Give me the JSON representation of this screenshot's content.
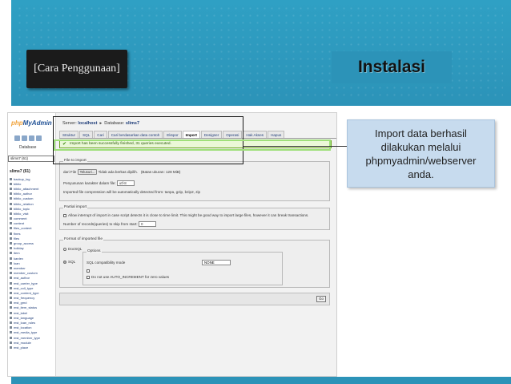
{
  "slide": {
    "section_label": "[Cara Penggunaan]",
    "title": "Instalasi",
    "note_lines": [
      "Import data berhasil",
      "dilakukan melalui",
      "phpmyadmin/webserver",
      "anda."
    ],
    "colors": {
      "header_blue": "#2c93b8",
      "note_bg": "#c7dbee",
      "label_bg": "#1b1b1b",
      "success_border": "#9fe07a"
    }
  },
  "pma": {
    "logo_a": "php",
    "logo_b": "MyAdmin",
    "db_header": "Database",
    "db_select": "slims7 (61)",
    "db_name": "slims7 (61)",
    "tables": [
      "backup_log",
      "biblio",
      "biblio_attachment",
      "biblio_author",
      "biblio_custom",
      "biblio_relation",
      "biblio_topic",
      "biblio_visit",
      "comment",
      "content",
      "files_content",
      "fines",
      "files",
      "group_access",
      "holiday",
      "item",
      "kardex",
      "loan",
      "member",
      "member_custom",
      "mst_author",
      "mst_carrier_type",
      "mst_coll_type",
      "mst_content_type",
      "mst_frequency",
      "mst_gmd",
      "mst_item_status",
      "mst_label",
      "mst_language",
      "mst_loan_rules",
      "mst_location",
      "mst_media_type",
      "mst_member_type",
      "mst_module",
      "mst_place"
    ],
    "breadcrumb_server_label": "Server:",
    "breadcrumb_server": "localhost",
    "breadcrumb_db_label": "Database:",
    "breadcrumb_db": "slims7",
    "tabs": [
      "Struktur",
      "SQL",
      "Cari",
      "Cari berdasarkan data contoh",
      "Ekspor",
      "Import",
      "Designer",
      "Operasi",
      "Hak Akses",
      "Hapus"
    ],
    "success_message": "Import has been successfully finished, 31 queries executed.",
    "file_legend": "File to import",
    "file_label": "dari File",
    "file_button": "Telusuri...",
    "file_status": "Tidak ada berkas dipilih.",
    "file_max": "(Batas ukuran: 128 MiB)",
    "charset_label": "Penyusunan karakter dalam file:",
    "charset_value": "utf-8",
    "compression_note": "Imported file compression will be automatically detected from: tanpa, gzip, bzip2, zip",
    "partial_legend": "Partial import",
    "partial_allow": "Allow interrupt of import in case script detects it is close to time limit. This might be good way to import large files, however it can break transactions.",
    "partial_skip": "Number of records(queries) to skip from start:",
    "partial_skip_value": "0",
    "format_legend": "Format of imported file",
    "format_docsql": "DocSQL",
    "format_sql": "SQL",
    "options_legend": "Options",
    "sql_compat_label": "SQL compatibility mode",
    "sql_compat_value": "NONE",
    "auto_increment": "Do not use AUTO_INCREMENT for zero values",
    "go_button": "Go"
  }
}
